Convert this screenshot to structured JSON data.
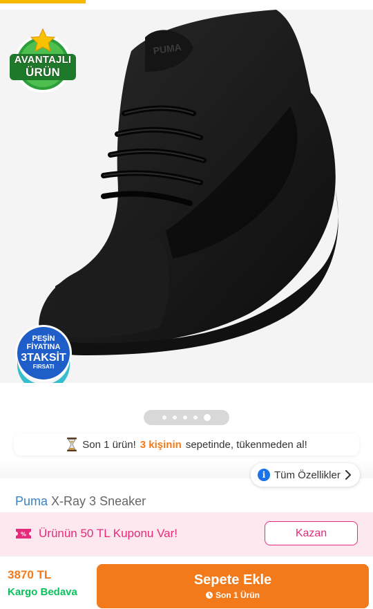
{
  "gallery": {
    "pager_dots": 5,
    "active_index": 4,
    "shoe_logo": "PUMA",
    "badges": {
      "avantajli_line1": "AVANTAJLI",
      "avantajli_line2": "ÜRÜN",
      "taksit_line1": "PEŞİN",
      "taksit_line2": "FİYATINA",
      "taksit_line3": "3TAKSİT",
      "taksit_line4": "FIRSATI"
    }
  },
  "stock_note": {
    "prefix": "Son 1 ürün!",
    "highlight": "3 kişinin",
    "suffix": "sepetinde, tükenmeden al!",
    "icon": "hourglass-icon"
  },
  "features_button": {
    "label": "Tüm Özellikler",
    "icon": "info-icon"
  },
  "product": {
    "brand": "Puma",
    "name": "X-Ray 3 Sneaker"
  },
  "coupon": {
    "text": "Ürünün 50 TL Kuponu Var!",
    "button": "Kazan",
    "color": "#e52b7a"
  },
  "bottom_bar": {
    "price": "3870 TL",
    "shipping": "Kargo Bedava",
    "cart_button": "Sepete Ekle",
    "cart_sub": "Son 1 Ürün",
    "accent": "#f27a1a"
  }
}
